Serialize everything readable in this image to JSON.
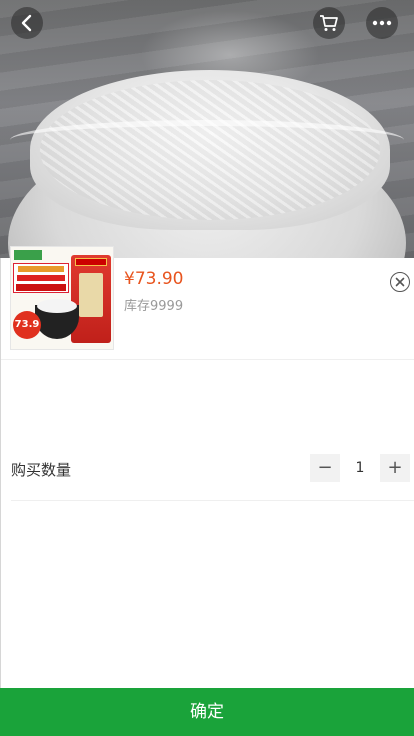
{
  "header": {
    "back_icon": "chevron-left-icon",
    "cart_icon": "cart-icon",
    "more_icon": "more-horizontal-icon"
  },
  "product": {
    "price": "¥73.90",
    "stock": "库存9999",
    "thumbnail_badge": "73.9"
  },
  "quantity": {
    "label": "购买数量",
    "decrement": "−",
    "value": "1",
    "increment": "+"
  },
  "footer": {
    "confirm_label": "确定"
  },
  "colors": {
    "accent_green": "#1aa33a",
    "price_orange": "#e8541e"
  }
}
